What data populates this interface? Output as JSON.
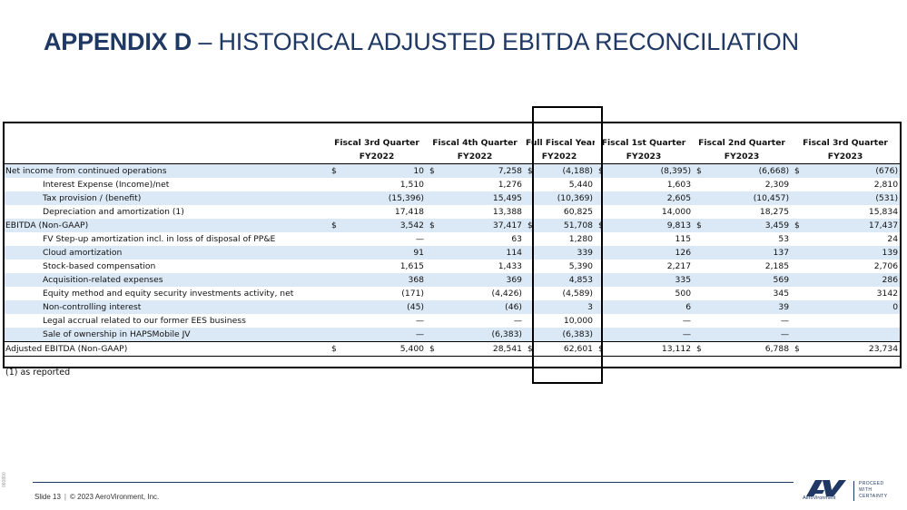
{
  "title": {
    "bold": "APPENDIX D",
    "rest": " – HISTORICAL ADJUSTED EBITDA RECONCILIATION"
  },
  "table": {
    "headers": [
      {
        "line1": "Fiscal 3rd Quarter",
        "line2": "FY2022"
      },
      {
        "line1": "Fiscal 4th Quarter",
        "line2": "FY2022"
      },
      {
        "line1": "Full Fiscal Year",
        "line2": "FY2022"
      },
      {
        "line1": "Fiscal 1st Quarter",
        "line2": "FY2023"
      },
      {
        "line1": "Fiscal 2nd Quarter",
        "line2": "FY2023"
      },
      {
        "line1": "Fiscal 3rd Quarter",
        "line2": "FY2023"
      }
    ],
    "currency_symbol": "$",
    "rows": [
      {
        "label": "Net income from continued operations",
        "values": [
          "10",
          "7,258",
          "(4,188)",
          "(8,395)",
          "(6,668)",
          "(676)"
        ]
      },
      {
        "label": "Interest Expense (Income)/net",
        "values": [
          "1,510",
          "1,276",
          "5,440",
          "1,603",
          "2,309",
          "2,810"
        ]
      },
      {
        "label": "Tax provision / (benefit)",
        "values": [
          "(15,396)",
          "15,495",
          "(10,369)",
          "2,605",
          "(10,457)",
          "(531)"
        ]
      },
      {
        "label": "Depreciation and amortization (1)",
        "values": [
          "17,418",
          "13,388",
          "60,825",
          "14,000",
          "18,275",
          "15,834"
        ]
      },
      {
        "label": "EBITDA (Non-GAAP)",
        "values": [
          "3,542",
          "37,417",
          "51,708",
          "9,813",
          "3,459",
          "17,437"
        ]
      },
      {
        "label": "FV Step-up amortization incl. in loss of disposal of PP&E",
        "values": [
          "—",
          "63",
          "1,280",
          "115",
          "53",
          "24"
        ]
      },
      {
        "label": "Cloud amortization",
        "values": [
          "91",
          "114",
          "339",
          "126",
          "137",
          "139"
        ]
      },
      {
        "label": "Stock-based compensation",
        "values": [
          "1,615",
          "1,433",
          "5,390",
          "2,217",
          "2,185",
          "2,706"
        ]
      },
      {
        "label": "Acquisition-related expenses",
        "values": [
          "368",
          "369",
          "4,853",
          "335",
          "569",
          "286"
        ]
      },
      {
        "label": "Equity method and equity security investments activity, net",
        "values": [
          "(171)",
          "(4,426)",
          "(4,589)",
          "500",
          "345",
          "3142"
        ]
      },
      {
        "label": "Non-controlling interest",
        "values": [
          "(45)",
          "(46)",
          "3",
          "6",
          "39",
          "0"
        ]
      },
      {
        "label": "Legal accrual related to our former EES business",
        "values": [
          "—",
          "—",
          "10,000",
          "—",
          "—",
          ""
        ]
      },
      {
        "label": "Sale of ownership in HAPSMobile JV",
        "values": [
          "—",
          "(6,383)",
          "(6,383)",
          "—",
          "—",
          ""
        ]
      },
      {
        "label": "Adjusted EBITDA (Non-GAAP)",
        "values": [
          "5,400",
          "28,541",
          "62,601",
          "13,112",
          "6,788",
          "23,734"
        ]
      }
    ]
  },
  "footnote": "(1) as reported",
  "footer": {
    "slide": "Slide 13",
    "copyright": "© 2023 AeroVironment, Inc.",
    "doc_code": "060800"
  },
  "logo": {
    "mark": "AV",
    "wordmark": "AeroVironment",
    "tagline": [
      "PROCEED",
      "WITH",
      "CERTAINTY"
    ]
  },
  "colors": {
    "title": "#1f3864",
    "row_shade": "#dbe9f7",
    "border": "#000000"
  }
}
